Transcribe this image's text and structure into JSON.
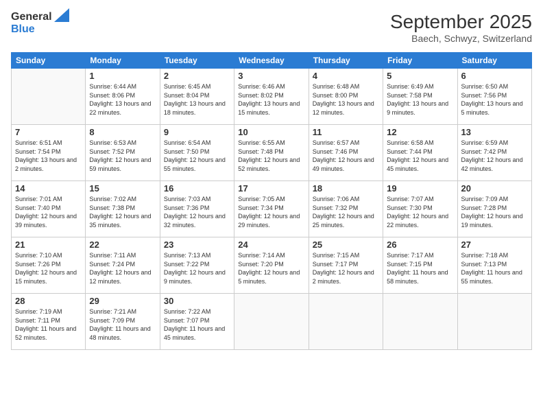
{
  "header": {
    "logo_general": "General",
    "logo_blue": "Blue",
    "month_year": "September 2025",
    "location": "Baech, Schwyz, Switzerland"
  },
  "days_of_week": [
    "Sunday",
    "Monday",
    "Tuesday",
    "Wednesday",
    "Thursday",
    "Friday",
    "Saturday"
  ],
  "weeks": [
    [
      {
        "day": "",
        "sunrise": "",
        "sunset": "",
        "daylight": ""
      },
      {
        "day": "1",
        "sunrise": "Sunrise: 6:44 AM",
        "sunset": "Sunset: 8:06 PM",
        "daylight": "Daylight: 13 hours and 22 minutes."
      },
      {
        "day": "2",
        "sunrise": "Sunrise: 6:45 AM",
        "sunset": "Sunset: 8:04 PM",
        "daylight": "Daylight: 13 hours and 18 minutes."
      },
      {
        "day": "3",
        "sunrise": "Sunrise: 6:46 AM",
        "sunset": "Sunset: 8:02 PM",
        "daylight": "Daylight: 13 hours and 15 minutes."
      },
      {
        "day": "4",
        "sunrise": "Sunrise: 6:48 AM",
        "sunset": "Sunset: 8:00 PM",
        "daylight": "Daylight: 13 hours and 12 minutes."
      },
      {
        "day": "5",
        "sunrise": "Sunrise: 6:49 AM",
        "sunset": "Sunset: 7:58 PM",
        "daylight": "Daylight: 13 hours and 9 minutes."
      },
      {
        "day": "6",
        "sunrise": "Sunrise: 6:50 AM",
        "sunset": "Sunset: 7:56 PM",
        "daylight": "Daylight: 13 hours and 5 minutes."
      }
    ],
    [
      {
        "day": "7",
        "sunrise": "Sunrise: 6:51 AM",
        "sunset": "Sunset: 7:54 PM",
        "daylight": "Daylight: 13 hours and 2 minutes."
      },
      {
        "day": "8",
        "sunrise": "Sunrise: 6:53 AM",
        "sunset": "Sunset: 7:52 PM",
        "daylight": "Daylight: 12 hours and 59 minutes."
      },
      {
        "day": "9",
        "sunrise": "Sunrise: 6:54 AM",
        "sunset": "Sunset: 7:50 PM",
        "daylight": "Daylight: 12 hours and 55 minutes."
      },
      {
        "day": "10",
        "sunrise": "Sunrise: 6:55 AM",
        "sunset": "Sunset: 7:48 PM",
        "daylight": "Daylight: 12 hours and 52 minutes."
      },
      {
        "day": "11",
        "sunrise": "Sunrise: 6:57 AM",
        "sunset": "Sunset: 7:46 PM",
        "daylight": "Daylight: 12 hours and 49 minutes."
      },
      {
        "day": "12",
        "sunrise": "Sunrise: 6:58 AM",
        "sunset": "Sunset: 7:44 PM",
        "daylight": "Daylight: 12 hours and 45 minutes."
      },
      {
        "day": "13",
        "sunrise": "Sunrise: 6:59 AM",
        "sunset": "Sunset: 7:42 PM",
        "daylight": "Daylight: 12 hours and 42 minutes."
      }
    ],
    [
      {
        "day": "14",
        "sunrise": "Sunrise: 7:01 AM",
        "sunset": "Sunset: 7:40 PM",
        "daylight": "Daylight: 12 hours and 39 minutes."
      },
      {
        "day": "15",
        "sunrise": "Sunrise: 7:02 AM",
        "sunset": "Sunset: 7:38 PM",
        "daylight": "Daylight: 12 hours and 35 minutes."
      },
      {
        "day": "16",
        "sunrise": "Sunrise: 7:03 AM",
        "sunset": "Sunset: 7:36 PM",
        "daylight": "Daylight: 12 hours and 32 minutes."
      },
      {
        "day": "17",
        "sunrise": "Sunrise: 7:05 AM",
        "sunset": "Sunset: 7:34 PM",
        "daylight": "Daylight: 12 hours and 29 minutes."
      },
      {
        "day": "18",
        "sunrise": "Sunrise: 7:06 AM",
        "sunset": "Sunset: 7:32 PM",
        "daylight": "Daylight: 12 hours and 25 minutes."
      },
      {
        "day": "19",
        "sunrise": "Sunrise: 7:07 AM",
        "sunset": "Sunset: 7:30 PM",
        "daylight": "Daylight: 12 hours and 22 minutes."
      },
      {
        "day": "20",
        "sunrise": "Sunrise: 7:09 AM",
        "sunset": "Sunset: 7:28 PM",
        "daylight": "Daylight: 12 hours and 19 minutes."
      }
    ],
    [
      {
        "day": "21",
        "sunrise": "Sunrise: 7:10 AM",
        "sunset": "Sunset: 7:26 PM",
        "daylight": "Daylight: 12 hours and 15 minutes."
      },
      {
        "day": "22",
        "sunrise": "Sunrise: 7:11 AM",
        "sunset": "Sunset: 7:24 PM",
        "daylight": "Daylight: 12 hours and 12 minutes."
      },
      {
        "day": "23",
        "sunrise": "Sunrise: 7:13 AM",
        "sunset": "Sunset: 7:22 PM",
        "daylight": "Daylight: 12 hours and 9 minutes."
      },
      {
        "day": "24",
        "sunrise": "Sunrise: 7:14 AM",
        "sunset": "Sunset: 7:20 PM",
        "daylight": "Daylight: 12 hours and 5 minutes."
      },
      {
        "day": "25",
        "sunrise": "Sunrise: 7:15 AM",
        "sunset": "Sunset: 7:17 PM",
        "daylight": "Daylight: 12 hours and 2 minutes."
      },
      {
        "day": "26",
        "sunrise": "Sunrise: 7:17 AM",
        "sunset": "Sunset: 7:15 PM",
        "daylight": "Daylight: 11 hours and 58 minutes."
      },
      {
        "day": "27",
        "sunrise": "Sunrise: 7:18 AM",
        "sunset": "Sunset: 7:13 PM",
        "daylight": "Daylight: 11 hours and 55 minutes."
      }
    ],
    [
      {
        "day": "28",
        "sunrise": "Sunrise: 7:19 AM",
        "sunset": "Sunset: 7:11 PM",
        "daylight": "Daylight: 11 hours and 52 minutes."
      },
      {
        "day": "29",
        "sunrise": "Sunrise: 7:21 AM",
        "sunset": "Sunset: 7:09 PM",
        "daylight": "Daylight: 11 hours and 48 minutes."
      },
      {
        "day": "30",
        "sunrise": "Sunrise: 7:22 AM",
        "sunset": "Sunset: 7:07 PM",
        "daylight": "Daylight: 11 hours and 45 minutes."
      },
      {
        "day": "",
        "sunrise": "",
        "sunset": "",
        "daylight": ""
      },
      {
        "day": "",
        "sunrise": "",
        "sunset": "",
        "daylight": ""
      },
      {
        "day": "",
        "sunrise": "",
        "sunset": "",
        "daylight": ""
      },
      {
        "day": "",
        "sunrise": "",
        "sunset": "",
        "daylight": ""
      }
    ]
  ]
}
